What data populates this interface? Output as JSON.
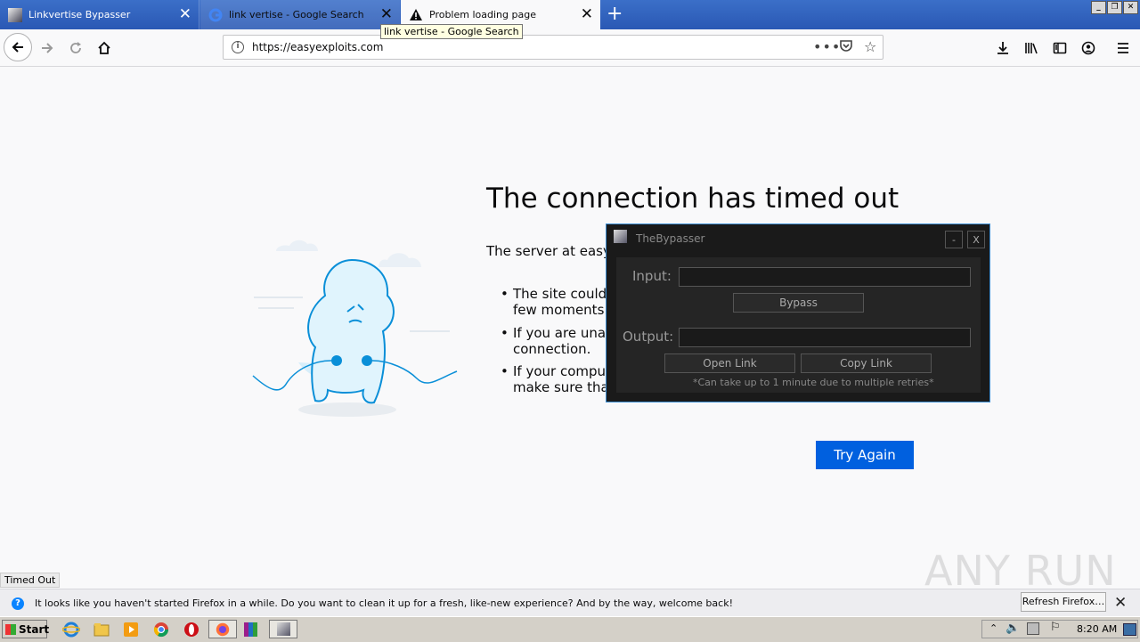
{
  "browser": {
    "tabs": [
      {
        "label": "Linkvertise Bypasser",
        "icon": "app-icon"
      },
      {
        "label": "link vertise - Google Search",
        "icon": "google-icon"
      },
      {
        "label": "Problem loading page",
        "icon": "warning-icon"
      }
    ],
    "tooltip": "link vertise - Google Search",
    "url": "https://easyexploits.com"
  },
  "error_page": {
    "title": "The connection has timed out",
    "description": "The server at easye",
    "bullets": [
      {
        "line1": "The site could b",
        "line2": "few moments."
      },
      {
        "line1": "If you are unabl",
        "line2": "connection."
      },
      {
        "line1": "If your compute",
        "line2": "make sure that"
      }
    ],
    "try_again": "Try Again"
  },
  "bypasser": {
    "title": "TheBypasser",
    "minimize": "-",
    "close": "X",
    "input_label": "Input:",
    "bypass_button": "Bypass",
    "output_label": "Output:",
    "open_link_button": "Open Link",
    "copy_link_button": "Copy Link",
    "note": "*Can take up to 1 minute due to multiple retries*"
  },
  "status_text": "Timed Out",
  "notification": {
    "text": "It looks like you haven't started Firefox in a while. Do you want to clean it up for a fresh, like-new experience? And by the way, welcome back!",
    "refresh_button": "Refresh Firefox…"
  },
  "taskbar": {
    "start": "Start",
    "clock": "8:20 AM"
  },
  "watermark": "ANY RUN"
}
